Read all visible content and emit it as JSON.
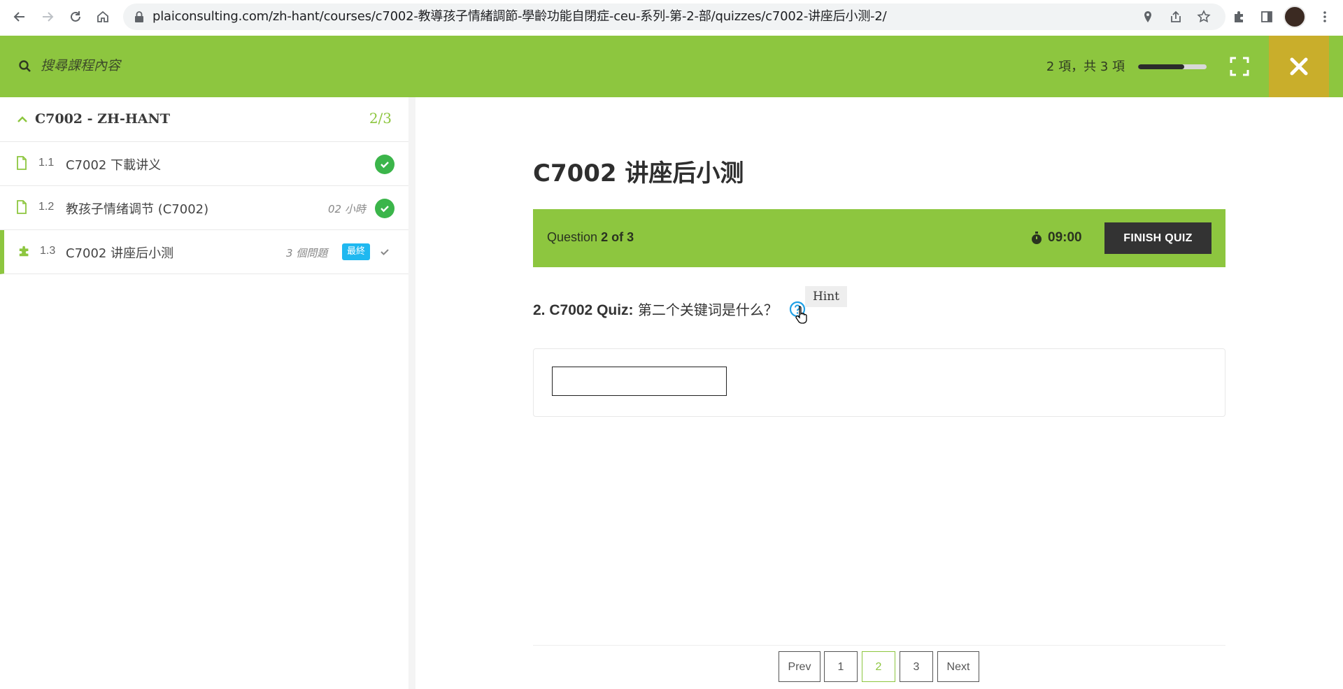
{
  "browser": {
    "url": "plaiconsulting.com/zh-hant/courses/c7002-教導孩子情緒調節-學齡功能自閉症-ceu-系列-第-2-部/quizzes/c7002-讲座后小测-2/"
  },
  "topbar": {
    "search_placeholder": "搜尋課程內容",
    "progress_text": "2 項，共 3 項",
    "progress_fraction": 0.67
  },
  "sidebar": {
    "course_title": "C7002 - ZH-HANT",
    "course_count": "2/3",
    "lessons": [
      {
        "number": "1.1",
        "title": "C7002 下載讲义",
        "meta": "",
        "badge": "",
        "status": "completed",
        "icon": "document-icon"
      },
      {
        "number": "1.2",
        "title": "教孩子情绪调节 (C7002)",
        "meta": "02 小時",
        "badge": "",
        "status": "completed",
        "icon": "document-icon"
      },
      {
        "number": "1.3",
        "title": "C7002 讲座后小测",
        "meta": "3 個問題",
        "badge": "最終",
        "status": "current",
        "icon": "puzzle-icon"
      }
    ]
  },
  "main": {
    "quiz_title": "C7002 讲座后小测",
    "question_bar": {
      "label": "Question",
      "current": "2 of 3",
      "timer": "09:00",
      "finish_label": "FINISH QUIZ"
    },
    "question": {
      "prefix": "2. C7002 Quiz:",
      "text": " 第二个关键词是什么？",
      "hint_label": "Hint"
    },
    "answer_value": ""
  },
  "pagination": {
    "prev_label": "Prev",
    "pages": [
      "1",
      "2",
      "3"
    ],
    "current_page": "2",
    "next_label": "Next"
  },
  "colors": {
    "accent_green": "#8dc63f",
    "close_gold": "#c9ae2b",
    "done_green": "#3bb54a",
    "badge_blue": "#1fb8f0",
    "finish_dark": "#333333"
  }
}
